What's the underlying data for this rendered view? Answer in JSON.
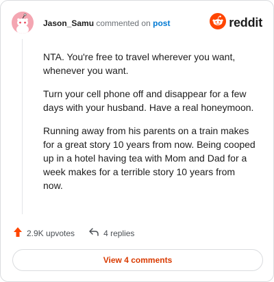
{
  "comment": {
    "username": "Jason_Samu",
    "action_text": "commented on",
    "post_link": "post",
    "paragraphs": [
      "NTA. You're free to travel wherever you want, whenever you want.",
      "Turn your cell phone off and disappear for a few days with your husband. Have a real honeymoon.",
      "Running away from his parents on a train makes for a great story 10 years from now. Being cooped up in a hotel having tea with Mom and Dad for a week makes for a terrible story 10 years from now."
    ]
  },
  "brand": {
    "name": "reddit",
    "icon": "reddit-alien-icon",
    "color": "#ff4500"
  },
  "footer": {
    "upvotes": "2.9K upvotes",
    "upvote_icon": "upvote-arrow-icon",
    "upvote_color": "#ff4500",
    "replies": "4 replies",
    "reply_icon": "reply-arrow-icon"
  },
  "view_comments": {
    "label": "View 4 comments",
    "color": "#d93a00"
  }
}
